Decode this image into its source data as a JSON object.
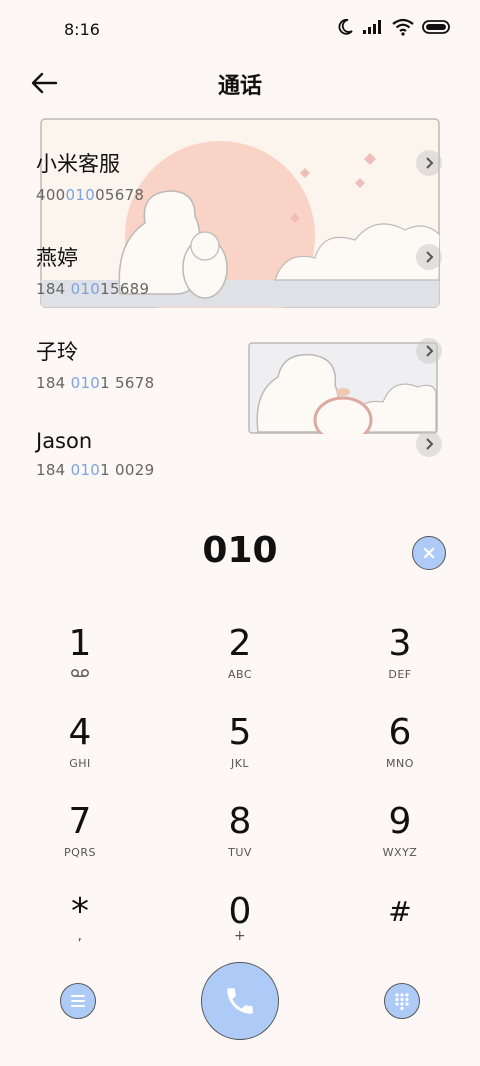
{
  "status": {
    "time": "8:16"
  },
  "header": {
    "title": "通话"
  },
  "contacts": [
    {
      "name": "小米客服",
      "number_pre": "400",
      "number_match": "010",
      "number_post": "05678"
    },
    {
      "name": "燕婷",
      "number_pre": "184 ",
      "number_match": "010",
      "number_post": "15689"
    },
    {
      "name": "子玲",
      "number_pre": "184 ",
      "number_match": "010",
      "number_post": "1 5678"
    },
    {
      "name": "Jason",
      "number_pre": "184 ",
      "number_match": "010",
      "number_post": "1 0029"
    }
  ],
  "dialer": {
    "input": "010",
    "keys": [
      {
        "digit": "1",
        "letters": ""
      },
      {
        "digit": "2",
        "letters": "ABC"
      },
      {
        "digit": "3",
        "letters": "DEF"
      },
      {
        "digit": "4",
        "letters": "GHI"
      },
      {
        "digit": "5",
        "letters": "JKL"
      },
      {
        "digit": "6",
        "letters": "MNO"
      },
      {
        "digit": "7",
        "letters": "PQRS"
      },
      {
        "digit": "8",
        "letters": "TUV"
      },
      {
        "digit": "9",
        "letters": "WXYZ"
      },
      {
        "digit": "*",
        "letters": ","
      },
      {
        "digit": "0",
        "letters": "+"
      },
      {
        "digit": "#",
        "letters": ""
      }
    ]
  },
  "icons": {
    "status": [
      "moon-icon",
      "signal-icon",
      "wifi-icon",
      "battery-icon"
    ],
    "back": "back-arrow-icon",
    "voicemail": "voicemail-icon",
    "clear": "close-icon",
    "menu": "menu-icon",
    "call": "phone-icon",
    "keypad": "keypad-icon"
  },
  "colors": {
    "background": "#fdf8f5",
    "accent": "#aecbf7",
    "match": "#7aa3e0"
  }
}
